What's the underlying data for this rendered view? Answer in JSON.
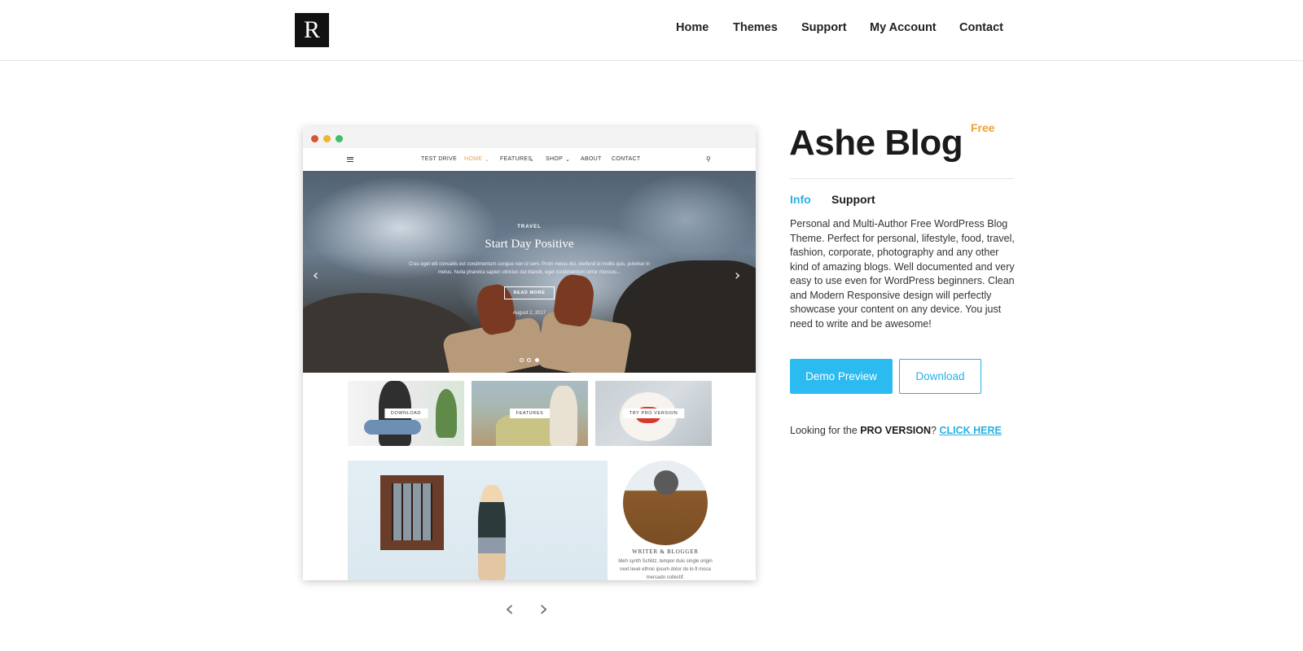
{
  "header": {
    "logo_letter": "R",
    "nav": [
      "Home",
      "Themes",
      "Support",
      "My Account",
      "Contact"
    ]
  },
  "preview": {
    "site_nav": {
      "items": [
        "TEST DRIVE",
        "HOME",
        "FEATURES",
        "SHOP",
        "ABOUT",
        "CONTACT"
      ],
      "active_color": "#e2a05c"
    },
    "hero": {
      "category": "TRAVEL",
      "title": "Start Day Positive",
      "excerpt": "Cras eget elit convallis est condimentum congue non id sem. Proin metus dui, eleifend id mollis quis, pulvinar in metus. Nulla pharetra sapien ultricies dui blandit, eget condimentum tortor rhoncus...",
      "button": "READ MORE",
      "date": "August 2, 2017"
    },
    "promo_boxes": [
      "DOWNLOAD",
      "FEATURES",
      "TRY PRO VERSION"
    ],
    "widget": {
      "heading": "WRITER & BLOGGER",
      "text": "Meh synth Schlitz, tempor duis single origin next level ethnic ipsum dolor do lo-fi moca mercado collectif."
    }
  },
  "theme": {
    "title": "Ashe Blog",
    "badge": "Free",
    "tabs": [
      "Info",
      "Support"
    ],
    "active_tab": "Info",
    "description": "Personal and Multi-Author Free WordPress Blog Theme.  Perfect for personal, lifestyle, food, travel, fashion, corporate, photography and any other kind of amazing blogs.  Well documented and very easy to use even for WordPress beginners. Clean and Modern Responsive design will perfectly showcase your content on any device. You just need to write and be awesome!",
    "demo_button": "Demo Preview",
    "download_button": "Download",
    "pro_prefix": "Looking for the",
    "pro_strong": "PRO VERSION",
    "pro_q": "?",
    "pro_link": "CLICK HERE"
  },
  "colors": {
    "accent": "#26b1e4",
    "badge": "#f0a030",
    "logo_bg": "#111111"
  }
}
